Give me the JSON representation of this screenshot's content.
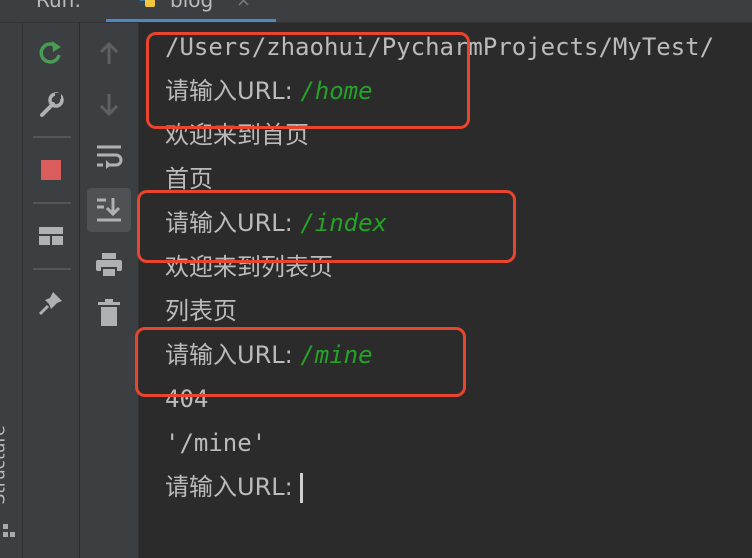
{
  "header": {
    "run_label": "Run:",
    "tab_title": "blog",
    "tab_close": "×"
  },
  "side": {
    "structure_label": "Structure"
  },
  "console": {
    "lines": [
      {
        "text": "/Users/zhaohui/PycharmProjects/MyTest/"
      },
      {
        "prompt": "请输入URL: ",
        "value": "/home"
      },
      {
        "text": "欢迎来到首页"
      },
      {
        "text": "首页"
      },
      {
        "prompt": "请输入URL: ",
        "value": "/index"
      },
      {
        "text": "欢迎来到列表页"
      },
      {
        "text": "列表页"
      },
      {
        "prompt": "请输入URL: ",
        "value": "/mine"
      },
      {
        "text": "404"
      },
      {
        "text": "'/mine'"
      },
      {
        "prompt": "请输入URL: ",
        "value": ""
      }
    ]
  },
  "colors": {
    "background": "#2b2b2b",
    "toolbar": "#3c3f41",
    "text": "#bbbbbb",
    "user_input": "#24a327",
    "highlight_border": "#e8442e",
    "stop_red": "#db5c5c",
    "rerun_green": "#499c54"
  },
  "icons": [
    "rerun-icon",
    "wrench-icon",
    "stop-icon",
    "layout-icon",
    "pin-icon",
    "arrow-up-icon",
    "arrow-down-icon",
    "soft-wrap-icon",
    "scroll-to-end-icon",
    "print-icon",
    "trash-icon",
    "python-icon"
  ]
}
